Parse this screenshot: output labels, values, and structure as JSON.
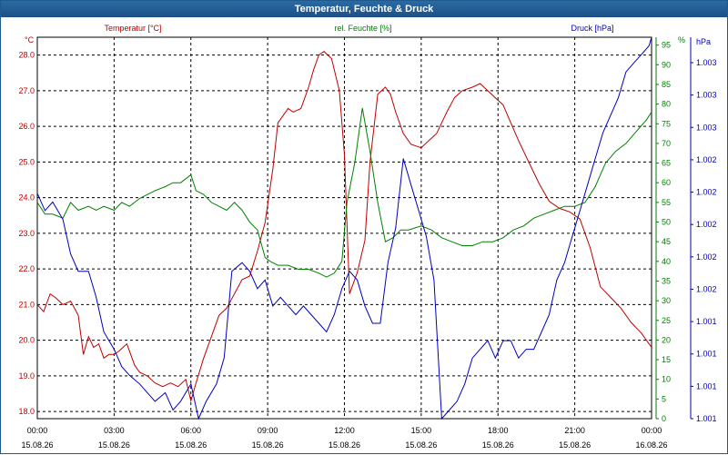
{
  "window": {
    "title": "Temperatur, Feuchte & Druck"
  },
  "chart_data": {
    "type": "line",
    "title": "Temperatur, Feuchte & Druck",
    "grid": true,
    "x_axis": {
      "ticks": [
        {
          "hour": 0,
          "time": "00:00",
          "date": "15.08.26"
        },
        {
          "hour": 3,
          "time": "03:00",
          "date": "15.08.26"
        },
        {
          "hour": 6,
          "time": "06:00",
          "date": "15.08.26"
        },
        {
          "hour": 9,
          "time": "09:00",
          "date": "15.08.26"
        },
        {
          "hour": 12,
          "time": "12:00",
          "date": "15.08.26"
        },
        {
          "hour": 15,
          "time": "15:00",
          "date": "15.08.26"
        },
        {
          "hour": 18,
          "time": "18:00",
          "date": "15.08.26"
        },
        {
          "hour": 21,
          "time": "21:00",
          "date": "15.08.26"
        },
        {
          "hour": 24,
          "time": "00:00",
          "date": "16.08.26"
        }
      ],
      "range": [
        0,
        24
      ]
    },
    "y_axes": {
      "temperature": {
        "label": "Temperatur [°C]",
        "unit": "°C",
        "color": "#c00000",
        "range": [
          17.8,
          28.5
        ],
        "ticks": [
          "18.0",
          "19.0",
          "20.0",
          "21.0",
          "22.0",
          "23.0",
          "24.0",
          "25.0",
          "26.0",
          "27.0",
          "28.0"
        ]
      },
      "humidity": {
        "label": "rel. Feuchte [%]",
        "unit": "%",
        "color": "#008000",
        "range": [
          0,
          97
        ],
        "ticks": [
          "0",
          "5",
          "10",
          "15",
          "20",
          "25",
          "30",
          "35",
          "40",
          "45",
          "50",
          "55",
          "60",
          "65",
          "70",
          "75",
          "80",
          "85",
          "90",
          "95"
        ]
      },
      "pressure": {
        "label": "Druck [hPa]",
        "unit": "hPa",
        "color": "#0000c0",
        "range": [
          1001.0,
          1003.2
        ],
        "ticks": [
          "1.001",
          "1.001",
          "1.001",
          "1.001",
          "1.002",
          "1.002",
          "1.002",
          "1.002",
          "1.002",
          "1.003",
          "1.003",
          "1.003"
        ]
      }
    },
    "series": [
      {
        "name": "Temperatur [°C]",
        "axis": "temperature",
        "color": "#c00000",
        "x": [
          0,
          0.25,
          0.5,
          0.7,
          1.0,
          1.3,
          1.6,
          1.8,
          2.0,
          2.2,
          2.4,
          2.6,
          2.8,
          3.0,
          3.2,
          3.5,
          3.8,
          4.0,
          4.3,
          4.6,
          4.9,
          5.2,
          5.5,
          5.8,
          6.0,
          6.2,
          6.5,
          6.8,
          7.1,
          7.4,
          7.7,
          8.0,
          8.3,
          8.6,
          8.9,
          9.2,
          9.4,
          9.6,
          9.8,
          10.0,
          10.3,
          10.6,
          10.8,
          11.0,
          11.2,
          11.5,
          11.8,
          12.0,
          12.2,
          12.5,
          12.8,
          13.0,
          13.3,
          13.6,
          13.8,
          14.0,
          14.3,
          14.6,
          15.0,
          15.3,
          15.6,
          16.0,
          16.3,
          16.6,
          17.0,
          17.3,
          17.6,
          17.9,
          18.2,
          18.5,
          18.8,
          19.2,
          19.6,
          20.0,
          20.4,
          20.8,
          21.2,
          21.6,
          22.0,
          22.4,
          22.8,
          23.2,
          23.6,
          24.0
        ],
        "values": [
          21.0,
          20.8,
          21.3,
          21.2,
          21.0,
          21.1,
          20.7,
          19.6,
          20.1,
          19.8,
          19.9,
          19.5,
          19.6,
          19.6,
          19.7,
          19.9,
          19.3,
          19.1,
          19.0,
          18.8,
          18.7,
          18.8,
          18.7,
          18.9,
          18.3,
          18.8,
          19.5,
          20.1,
          20.7,
          20.9,
          21.3,
          21.7,
          21.8,
          22.5,
          23.3,
          24.8,
          26.1,
          26.3,
          26.5,
          26.4,
          26.5,
          27.1,
          27.6,
          28.0,
          28.1,
          27.9,
          27.0,
          25.2,
          21.3,
          21.9,
          22.8,
          25.0,
          26.9,
          27.1,
          26.9,
          26.4,
          25.8,
          25.5,
          25.4,
          25.6,
          25.8,
          26.4,
          26.8,
          27.0,
          27.1,
          27.2,
          27.0,
          26.8,
          26.6,
          26.1,
          25.6,
          25.0,
          24.4,
          23.9,
          23.7,
          23.6,
          23.4,
          22.6,
          21.5,
          21.2,
          20.9,
          20.5,
          20.2,
          19.8
        ]
      },
      {
        "name": "rel. Feuchte [%]",
        "axis": "humidity",
        "color": "#008000",
        "x": [
          0,
          0.3,
          0.6,
          1.0,
          1.3,
          1.6,
          2.0,
          2.3,
          2.6,
          3.0,
          3.3,
          3.6,
          4.0,
          4.3,
          4.6,
          5.0,
          5.3,
          5.6,
          6.0,
          6.2,
          6.5,
          6.8,
          7.1,
          7.4,
          7.7,
          8.0,
          8.3,
          8.6,
          8.9,
          9.1,
          9.4,
          9.8,
          10.2,
          10.6,
          11.0,
          11.3,
          11.6,
          11.9,
          12.1,
          12.4,
          12.7,
          13.0,
          13.3,
          13.6,
          13.9,
          14.2,
          14.5,
          15.0,
          15.4,
          15.8,
          16.2,
          16.6,
          17.0,
          17.4,
          17.8,
          18.2,
          18.6,
          19.0,
          19.4,
          19.8,
          20.2,
          20.6,
          21.0,
          21.4,
          21.8,
          22.2,
          22.6,
          23.0,
          23.4,
          23.8,
          24.0
        ],
        "values": [
          55,
          52,
          52,
          51,
          55,
          53,
          54,
          53,
          54,
          53,
          55,
          54,
          56,
          57,
          58,
          59,
          60,
          60,
          62,
          58,
          57,
          55,
          54,
          53,
          55,
          53,
          50,
          48,
          41,
          40,
          39,
          39,
          38,
          38,
          37,
          36,
          37,
          40,
          55,
          65,
          79,
          68,
          55,
          45,
          46,
          48,
          48,
          49,
          48,
          46,
          45,
          44,
          44,
          45,
          45,
          46,
          48,
          49,
          51,
          52,
          53,
          54,
          54,
          55,
          59,
          65,
          68,
          70,
          73,
          76,
          78
        ]
      },
      {
        "name": "Druck [hPa]",
        "axis": "pressure",
        "color": "#0000c0",
        "x": [
          0,
          0.3,
          0.6,
          1.0,
          1.3,
          1.6,
          2.0,
          2.3,
          2.6,
          3.0,
          3.3,
          3.6,
          4.0,
          4.3,
          4.6,
          5.0,
          5.3,
          5.6,
          6.0,
          6.3,
          6.6,
          7.0,
          7.3,
          7.6,
          8.0,
          8.3,
          8.6,
          8.9,
          9.2,
          9.5,
          9.8,
          10.1,
          10.4,
          10.7,
          11.0,
          11.3,
          11.6,
          11.9,
          12.2,
          12.5,
          12.8,
          13.1,
          13.4,
          13.7,
          14.0,
          14.3,
          14.6,
          14.9,
          15.2,
          15.5,
          15.8,
          16.1,
          16.4,
          16.7,
          17.0,
          17.3,
          17.6,
          17.9,
          18.2,
          18.5,
          18.8,
          19.1,
          19.4,
          19.7,
          20.0,
          20.3,
          20.6,
          20.9,
          21.2,
          21.5,
          21.8,
          22.1,
          22.4,
          22.7,
          23.0,
          23.3,
          23.6,
          23.9,
          24.0
        ],
        "values": [
          1002.3,
          1002.2,
          1002.25,
          1002.15,
          1001.95,
          1001.85,
          1001.85,
          1001.7,
          1001.5,
          1001.4,
          1001.3,
          1001.25,
          1001.2,
          1001.15,
          1001.1,
          1001.15,
          1001.05,
          1001.1,
          1001.2,
          1001.0,
          1001.1,
          1001.2,
          1001.35,
          1001.85,
          1001.9,
          1001.85,
          1001.75,
          1001.8,
          1001.65,
          1001.7,
          1001.65,
          1001.6,
          1001.65,
          1001.6,
          1001.55,
          1001.5,
          1001.6,
          1001.75,
          1001.85,
          1001.8,
          1001.65,
          1001.55,
          1001.55,
          1001.9,
          1002.1,
          1002.5,
          1002.35,
          1002.2,
          1002.05,
          1001.8,
          1001.0,
          1001.05,
          1001.1,
          1001.2,
          1001.35,
          1001.4,
          1001.45,
          1001.35,
          1001.45,
          1001.45,
          1001.35,
          1001.4,
          1001.4,
          1001.5,
          1001.6,
          1001.8,
          1001.9,
          1002.05,
          1002.2,
          1002.35,
          1002.5,
          1002.65,
          1002.75,
          1002.85,
          1003.0,
          1003.05,
          1003.1,
          1003.15,
          1003.2
        ]
      }
    ]
  }
}
